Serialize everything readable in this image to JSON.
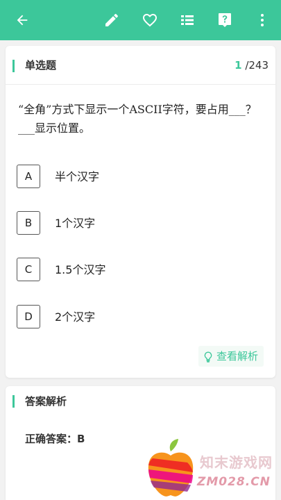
{
  "toolbar": {
    "icons": [
      "back-arrow-icon",
      "pencil-icon",
      "heart-icon",
      "list-icon",
      "help-icon",
      "more-vert-icon"
    ],
    "color": "#3cc79a"
  },
  "question_card": {
    "type_label": "单选题",
    "current_index": "1",
    "total_label": "/243",
    "question_text": "“全角”方式下显示一个ASCII字符，要占用___？ ___显示位置。",
    "options": [
      {
        "letter": "A",
        "text": "半个汉字"
      },
      {
        "letter": "B",
        "text": "1个汉字"
      },
      {
        "letter": "C",
        "text": "1.5个汉字"
      },
      {
        "letter": "D",
        "text": "2个汉字"
      }
    ],
    "analysis_button_label": "查看解析"
  },
  "analysis_card": {
    "title": "答案解析",
    "answer_text": "正确答案：B"
  },
  "watermark": {
    "line1": "知末游戏网",
    "line2": "ZM028.CN"
  }
}
